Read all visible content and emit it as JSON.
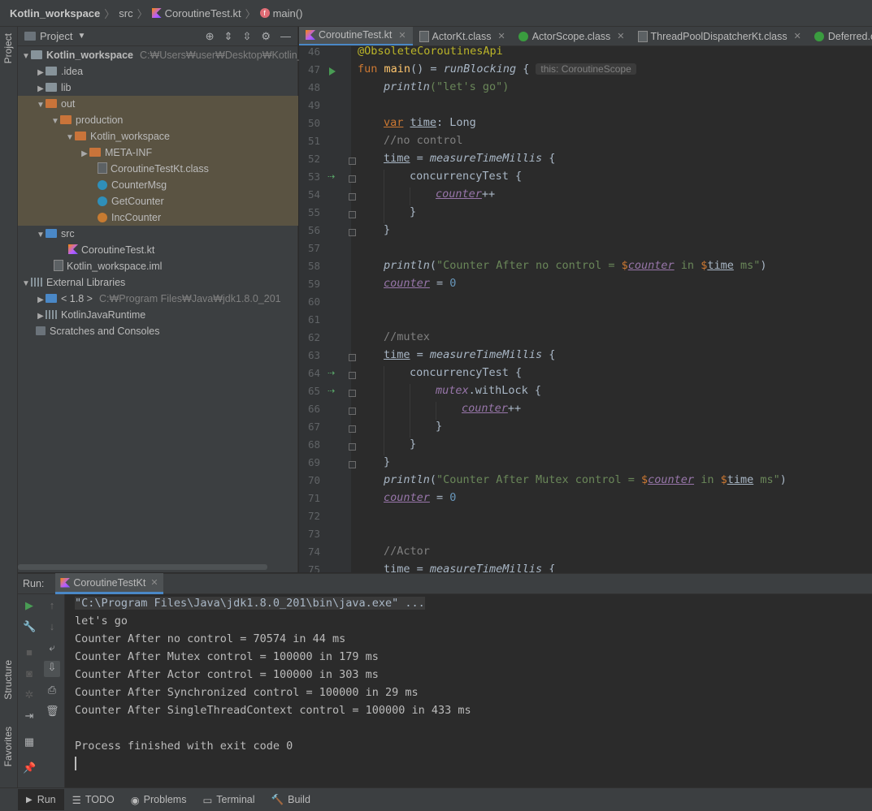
{
  "breadcrumb": {
    "project": "Kotlin_workspace",
    "src": "src",
    "file": "CoroutineTest.kt",
    "fn": "main()"
  },
  "sidebar_left": {
    "project_tab": "Project",
    "structure_tab": "Structure",
    "favorites_tab": "Favorites"
  },
  "project_panel": {
    "title": "Project",
    "tree": [
      {
        "label": "Kotlin_workspace",
        "hint": "C:₩Users₩user₩Desktop₩Kotlin_wor"
      },
      {
        "label": ".idea"
      },
      {
        "label": "lib"
      },
      {
        "label": "out"
      },
      {
        "label": "production"
      },
      {
        "label": "Kotlin_workspace"
      },
      {
        "label": "META-INF"
      },
      {
        "label": "CoroutineTestKt.class"
      },
      {
        "label": "CounterMsg"
      },
      {
        "label": "GetCounter"
      },
      {
        "label": "IncCounter"
      },
      {
        "label": "src"
      },
      {
        "label": "CoroutineTest.kt"
      },
      {
        "label": "Kotlin_workspace.iml"
      },
      {
        "label": "External Libraries"
      },
      {
        "label": "< 1.8 >",
        "hint": "C:₩Program Files₩Java₩jdk1.8.0_201"
      },
      {
        "label": "KotlinJavaRuntime"
      },
      {
        "label": "Scratches and Consoles"
      }
    ]
  },
  "tabs": [
    {
      "label": "CoroutineTest.kt"
    },
    {
      "label": "ActorKt.class"
    },
    {
      "label": "ActorScope.class"
    },
    {
      "label": "ThreadPoolDispatcherKt.class"
    },
    {
      "label": "Deferred.class"
    }
  ],
  "editor": {
    "line_numbers": [
      "46",
      "47",
      "48",
      "49",
      "50",
      "51",
      "52",
      "53",
      "54",
      "55",
      "56",
      "57",
      "58",
      "59",
      "60",
      "61",
      "62",
      "63",
      "64",
      "65",
      "66",
      "67",
      "68",
      "69",
      "70",
      "71",
      "72",
      "73",
      "74",
      "75"
    ],
    "inlay_hint": "this: CoroutineScope",
    "tokens": {
      "ann": "@ObsoleteCoroutinesApi",
      "fun_kw": "fun",
      "main": "main",
      "eq_paren": "() = ",
      "runBlocking": "runBlocking",
      "brace_open": " {",
      "brace_close": "}",
      "println": "println",
      "lets_go": "(\"let's go\")",
      "var_kw": "var",
      "time": "time",
      "time_decl": ": Long",
      "cm_no_control": "//no control",
      "assign": " = ",
      "measure": "measureTimeMillis",
      "concurrency": "concurrencyTest {",
      "counter": "counter",
      "incr": "++",
      "paren_open": "(",
      "paren_close": ")",
      "str_no_control": "\"Counter After no control = ",
      "dollar": "$",
      "str_in": " in ",
      "str_ms": " ms\"",
      "zero": "0",
      "cm_mutex": "//mutex",
      "mutex": "mutex",
      "withlock": ".withLock {",
      "str_mutex": "\"Counter After Mutex control = ",
      "cm_actor": "//Actor"
    }
  },
  "run_panel": {
    "label": "Run:",
    "tab": "CoroutineTestKt",
    "lines": [
      "\"C:\\Program Files\\Java\\jdk1.8.0_201\\bin\\java.exe\" ...",
      "let's go",
      "Counter After no control = 70574 in 44 ms",
      "Counter After Mutex control = 100000 in 179 ms",
      "Counter After Actor control = 100000 in 303 ms",
      "Counter After Synchronized control = 100000 in 29 ms",
      "Counter After SingleThreadContext control = 100000 in 433 ms",
      "",
      "Process finished with exit code 0"
    ]
  },
  "bottom_bar": [
    {
      "label": "Run"
    },
    {
      "label": "TODO"
    },
    {
      "label": "Problems"
    },
    {
      "label": "Terminal"
    },
    {
      "label": "Build"
    }
  ]
}
